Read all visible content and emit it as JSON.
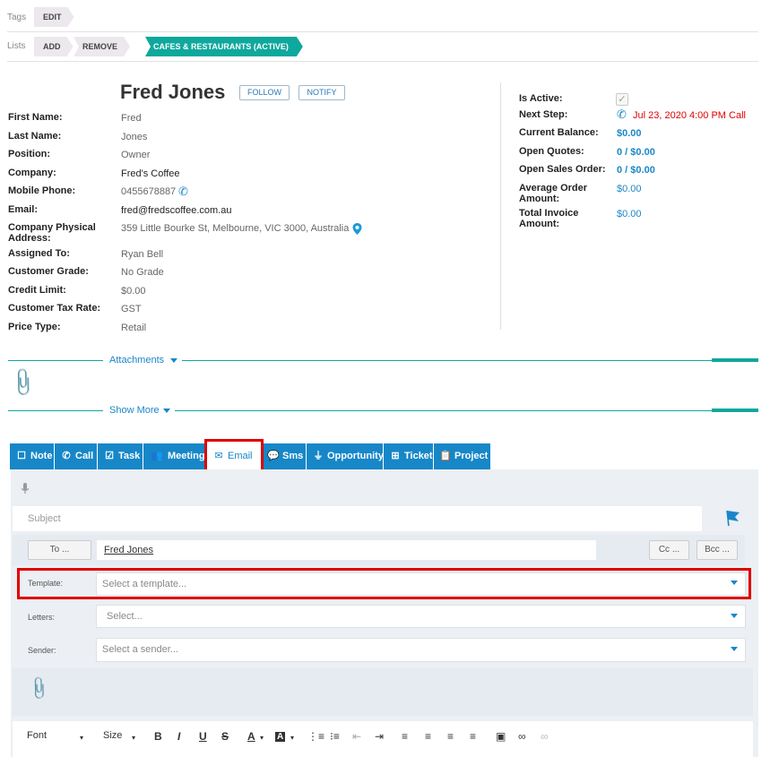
{
  "tags": {
    "label": "Tags",
    "edit": "EDIT"
  },
  "lists": {
    "label": "Lists",
    "add": "ADD",
    "remove": "REMOVE",
    "active_list": "CAFES & RESTAURANTS (ACTIVE)"
  },
  "contact": {
    "name": "Fred Jones",
    "follow": "FOLLOW",
    "notify": "NOTIFY",
    "fields": [
      {
        "label": "First Name:",
        "value": "Fred"
      },
      {
        "label": "Last Name:",
        "value": "Jones"
      },
      {
        "label": "Position:",
        "value": "Owner"
      },
      {
        "label": "Company:",
        "value": "Fred's Coffee"
      },
      {
        "label": "Mobile Phone:",
        "value": "0455678887"
      },
      {
        "label": "Email:",
        "value": "fred@fredscoffee.com.au"
      },
      {
        "label": "Company Physical Address:",
        "value": "359 Little Bourke St, Melbourne, VIC 3000, Australia"
      },
      {
        "label": "Assigned To:",
        "value": "Ryan Bell"
      },
      {
        "label": "Customer Grade:",
        "value": "No Grade"
      },
      {
        "label": "Credit Limit:",
        "value": "$0.00"
      },
      {
        "label": "Customer Tax Rate:",
        "value": "GST"
      },
      {
        "label": "Price Type:",
        "value": "Retail"
      }
    ]
  },
  "summary": {
    "is_active_label": "Is Active:",
    "next_step_label": "Next Step:",
    "next_step_value": "Jul 23, 2020 4:00 PM Call",
    "current_balance_label": "Current Balance:",
    "current_balance_value": "$0.00",
    "open_quotes_label": "Open Quotes:",
    "open_quotes_value": "0 / $0.00",
    "open_sales_order_label": "Open Sales Order:",
    "open_sales_order_value": "0 / $0.00",
    "avg_order_label": "Average Order Amount:",
    "avg_order_value": "$0.00",
    "total_invoice_label": "Total Invoice Amount:",
    "total_invoice_value": "$0.00"
  },
  "sections": {
    "attachments": "Attachments",
    "show_more": "Show More"
  },
  "tabs": [
    {
      "label": "Note",
      "icon": "note-icon",
      "glyph": "☐"
    },
    {
      "label": "Call",
      "icon": "phone-icon",
      "glyph": "✆"
    },
    {
      "label": "Task",
      "icon": "task-icon",
      "glyph": "☑"
    },
    {
      "label": "Meeting",
      "icon": "people-icon",
      "glyph": "👥"
    },
    {
      "label": "Email",
      "icon": "email-icon",
      "glyph": "✉"
    },
    {
      "label": "Sms",
      "icon": "sms-icon",
      "glyph": "💬"
    },
    {
      "label": "Opportunity",
      "icon": "filter-icon",
      "glyph": "⏚"
    },
    {
      "label": "Ticket",
      "icon": "ticket-icon",
      "glyph": "⊞"
    },
    {
      "label": "Project",
      "icon": "clipboard-icon",
      "glyph": "📋"
    }
  ],
  "email_form": {
    "subject_placeholder": "Subject",
    "to_button": "To ...",
    "to_value": "Fred Jones",
    "cc_button": "Cc ...",
    "bcc_button": "Bcc ...",
    "template_label": "Template:",
    "template_placeholder": "Select a template...",
    "letters_label": "Letters:",
    "letters_placeholder": "Select...",
    "sender_label": "Sender:",
    "sender_placeholder": "Select a sender..."
  },
  "toolbar": {
    "font": "Font",
    "size": "Size",
    "bold": "B",
    "italic": "I",
    "underline": "U",
    "strike": "S",
    "font_color": "A",
    "highlight": "A"
  },
  "colors": {
    "accent_teal": "#0fa89c",
    "accent_blue": "#1787c8",
    "alert_red": "#e00000"
  }
}
